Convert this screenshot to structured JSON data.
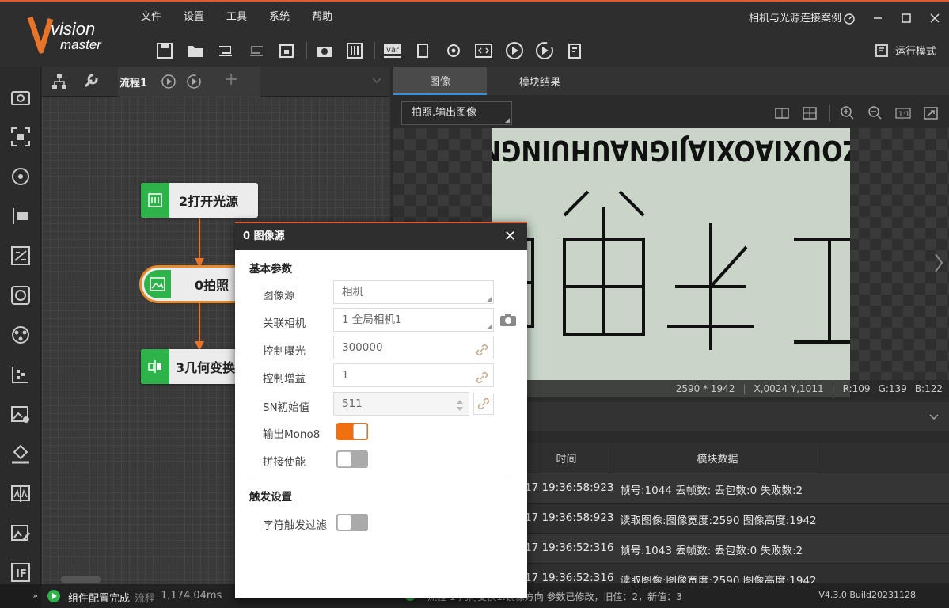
{
  "app": {
    "logo_line1": "vision",
    "logo_line2": "master",
    "solution_title": "相机与光源连接案例",
    "version": "V4.3.0 Build20231128"
  },
  "menu": [
    "文件",
    "设置",
    "工具",
    "系统",
    "帮助"
  ],
  "toolbar": {
    "run_mode": "运行模式"
  },
  "flow": {
    "tab_name": "流程1"
  },
  "nodes": {
    "n1": "2打开光源",
    "n2": "0拍照",
    "n3": "3几何变换"
  },
  "right_tabs": {
    "image": "图像",
    "result": "模块结果"
  },
  "image_select": "拍照.输出图像",
  "image_status": {
    "size": "2590 * 1942",
    "coords": "X,0024  Y,1011",
    "r": "R:109",
    "g": "G:139",
    "b": "B:122"
  },
  "photo_text": {
    "top_line": "ZOUXIAOXIAJIGNAUHUINGN",
    "chars": "工车单由"
  },
  "table": {
    "headers": {
      "time": "时间",
      "data": "模块数据"
    },
    "rows": [
      {
        "time": "17 19:36:58:923",
        "data": "帧号:1044 丢帧数: 丢包数:0 失败数:2"
      },
      {
        "time": "17 19:36:58:923",
        "data": "读取图像:图像宽度:2590 图像高度:1942"
      },
      {
        "time": "17 19:36:52:316",
        "data": "帧号:1043 丢帧数: 丢包数:0 失败数:2"
      },
      {
        "time": "17 19:36:52:316",
        "data": "读取图像:图像宽度:2590 图像高度:1942"
      }
    ]
  },
  "bottom": {
    "status": "组件配置完成",
    "flow_label": "流程",
    "flow_time": "1,174.04ms",
    "log": "流程 1 几何变换1.镜像方向 参数已修改，旧值：2，新值：3"
  },
  "dialog": {
    "title": "0 图像源",
    "section_basic": "基本参数",
    "fields": {
      "source": {
        "label": "图像源",
        "value": "相机"
      },
      "camera": {
        "label": "关联相机",
        "value": "1 全局相机1"
      },
      "exposure": {
        "label": "控制曝光",
        "value": "300000"
      },
      "gain": {
        "label": "控制增益",
        "value": "1"
      },
      "sn": {
        "label": "SN初始值",
        "value": "511"
      },
      "mono8": {
        "label": "输出Mono8",
        "on": true
      },
      "stitch": {
        "label": "拼接使能",
        "on": false
      }
    },
    "section_trigger": "触发设置",
    "trigger_filter": {
      "label": "字符触发过滤",
      "on": false
    }
  },
  "colors": {
    "accent": "#e05a2a",
    "node_green": "#2db34a",
    "toggle_on": "#f07010",
    "tab_blue": "#3a8fd9"
  }
}
